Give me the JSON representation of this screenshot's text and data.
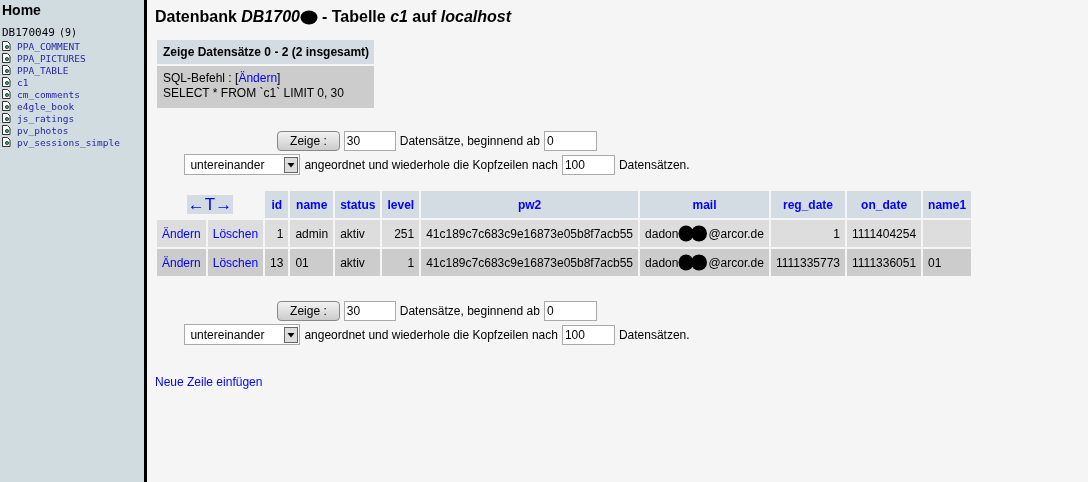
{
  "sidebar": {
    "home": "Home",
    "database": {
      "name": "DB170049",
      "count": "(9)"
    },
    "tables": [
      "PPA_COMMENT",
      "PPA_PICTURES",
      "PPA_TABLE",
      "c1",
      "cm_comments",
      "e4gle_book",
      "js_ratings",
      "pv_photos",
      "pv_sessions_simple"
    ]
  },
  "title": {
    "before": "Datenbank *DB1700*",
    "after": "- Tabelle *c1* auf *localhost*"
  },
  "summary": {
    "heading": "Zeige Datensätze 0 - 2 (2 insgesamt)",
    "sql_label": "SQL-Befehl : [",
    "sql_link": "Ändern",
    "sql_close": "]",
    "query": "SELECT * FROM `c1` LIMIT 0, 30"
  },
  "nav_forms": [
    {
      "button": "Zeige :",
      "rows_value": "30",
      "rows_label": "Datensätze, beginnend ab",
      "start_value": "0",
      "mode_value": "untereinander",
      "mode_label": "angeordnet und wiederhole die Kopfzeilen nach",
      "repeat_value": "100",
      "repeat_label": "Datensätzen."
    },
    {
      "button": "Zeige :",
      "rows_value": "30",
      "rows_label": "Datensätze, beginnend ab",
      "start_value": "0",
      "mode_value": "untereinander",
      "mode_label": "angeordnet und wiederhole die Kopfzeilen nach",
      "repeat_value": "100",
      "repeat_label": "Datensätzen."
    }
  ],
  "table": {
    "sort_arrows": "←T→",
    "columns": [
      "id",
      "name",
      "status",
      "level",
      "pw2",
      "mail",
      "reg_date",
      "on_date",
      "name1"
    ],
    "rows": [
      {
        "edit": "Ändern",
        "delete": "Löschen",
        "cells": [
          {
            "kind": "number",
            "text": "1"
          },
          {
            "kind": "text",
            "text": "admin"
          },
          {
            "kind": "text",
            "text": "aktiv"
          },
          {
            "kind": "number",
            "text": "251"
          },
          {
            "kind": "text",
            "text": "41c189c7c683c9e16873e05b8f7acb55"
          },
          {
            "kind": "redacted",
            "before": "dadon",
            "after": "@arcor.de"
          },
          {
            "kind": "number",
            "text": "1"
          },
          {
            "kind": "text",
            "text": "1111404254"
          },
          {
            "kind": "empty"
          }
        ]
      },
      {
        "edit": "Ändern",
        "delete": "Löschen",
        "cells": [
          {
            "kind": "number",
            "text": "13"
          },
          {
            "kind": "text",
            "text": "01"
          },
          {
            "kind": "text",
            "text": "aktiv"
          },
          {
            "kind": "number",
            "text": "1"
          },
          {
            "kind": "text",
            "text": "41c189c7c683c9e16873e05b8f7acb55"
          },
          {
            "kind": "redacted",
            "before": "dadon",
            "after": "@arcor.de"
          },
          {
            "kind": "number",
            "text": "1111335773"
          },
          {
            "kind": "text",
            "text": "1111336051"
          },
          {
            "kind": "text",
            "text": "01"
          }
        ]
      }
    ]
  },
  "insert_link": "Neue Zeile einfügen"
}
